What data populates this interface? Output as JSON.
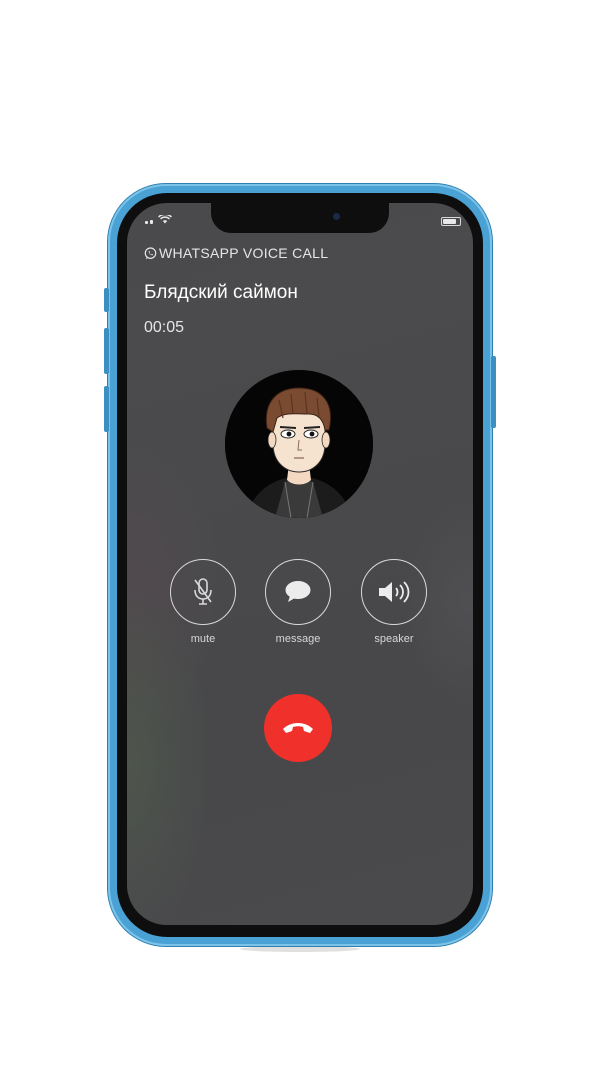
{
  "call": {
    "type_label": "WHATSAPP VOICE CALL",
    "contact_name": "Блядский саймон",
    "timer": "00:05"
  },
  "controls": {
    "mute_label": "mute",
    "message_label": "message",
    "speaker_label": "speaker"
  },
  "icons": {
    "whatsapp": "whatsapp-icon",
    "mute": "mic-off-icon",
    "message": "speech-bubble-icon",
    "speaker": "speaker-icon",
    "end_call": "phone-hangup-icon"
  },
  "colors": {
    "phone_frame": "#4aa1d3",
    "screen_bg": "#4a4a4c",
    "end_call": "#f0302b",
    "control_stroke": "#d9d9d9"
  }
}
